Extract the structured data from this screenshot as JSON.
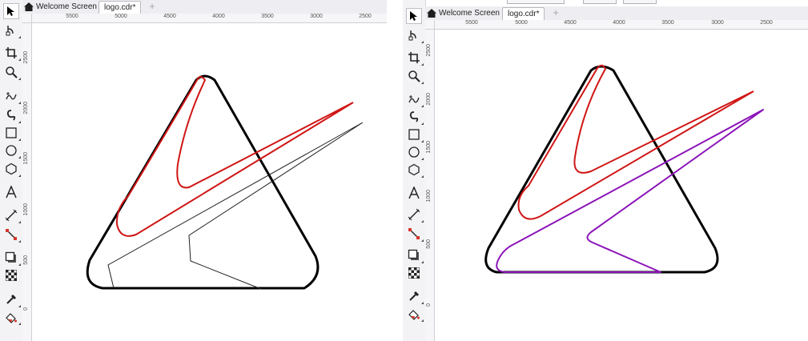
{
  "panes": [
    {
      "id": "left",
      "tabs": {
        "home_label": "Welcome Screen",
        "doc_label": "logo.cdr*",
        "new_tab_symbol": "+"
      },
      "ruler": {
        "horizontal": [
          "5500",
          "5000",
          "4500",
          "4000",
          "3500",
          "3000",
          "2500"
        ],
        "vertical": [
          "2500",
          "2000",
          "1500",
          "1000",
          "500",
          "0"
        ]
      }
    },
    {
      "id": "right",
      "tabs": {
        "home_label": "Welcome Screen",
        "doc_label": "logo.cdr*",
        "new_tab_symbol": "+"
      },
      "ruler": {
        "horizontal": [
          "5500",
          "5000",
          "4500",
          "4000",
          "3500",
          "3000",
          "2500"
        ],
        "vertical": [
          "2500",
          "2000",
          "1500",
          "1000",
          "500",
          "0"
        ]
      }
    }
  ],
  "toolbox_icons": [
    "pick-tool-icon",
    "shape-tool-icon",
    "crop-tool-icon",
    "zoom-tool-icon",
    "freehand-tool-icon",
    "artistic-media-icon",
    "rectangle-tool-icon",
    "ellipse-tool-icon",
    "polygon-tool-icon",
    "text-tool-icon",
    "parallel-dimension-icon",
    "connector-tool-icon",
    "drop-shadow-icon",
    "transparency-icon",
    "color-eyedropper-icon",
    "interactive-fill-icon"
  ],
  "colors": {
    "triangle_outline": "#000000",
    "swoosh_red": "#d01515",
    "selected_path_purple": "#8b14b8",
    "thin_path": "#222222",
    "ui_panel": "#f3f3f5"
  }
}
